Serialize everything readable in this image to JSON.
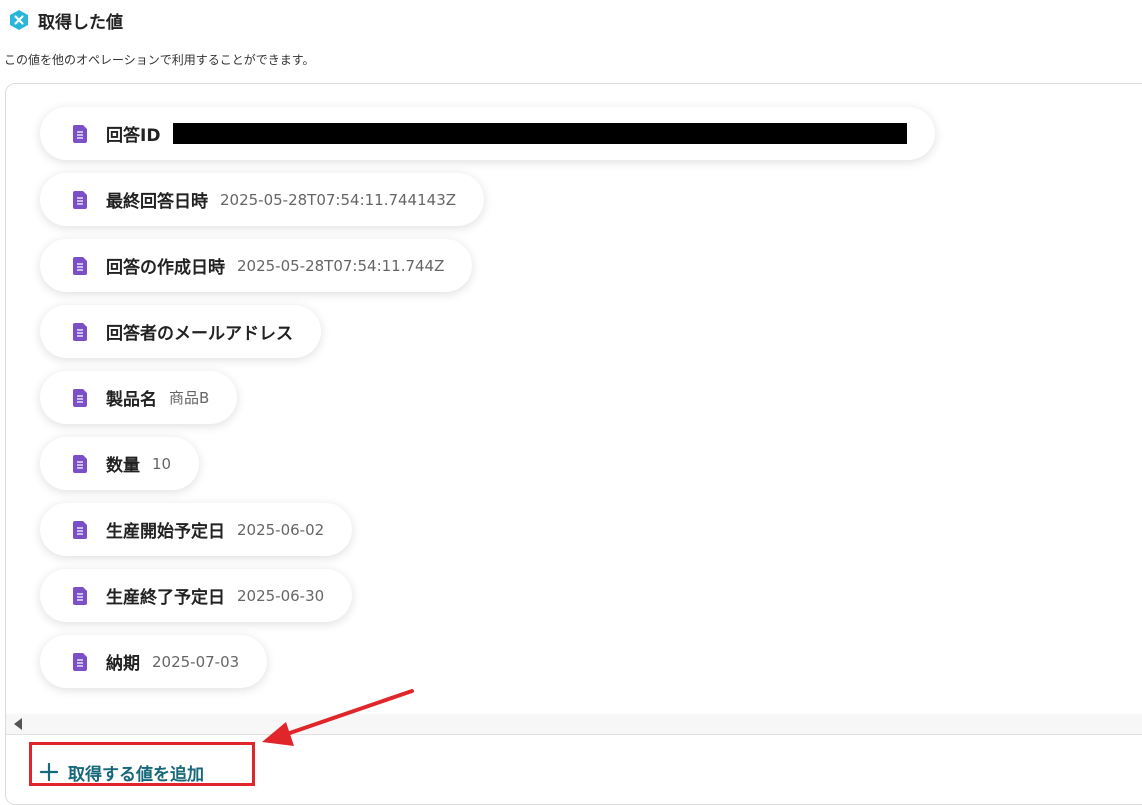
{
  "header": {
    "title": "取得した値",
    "icon": "x-hexagon-icon"
  },
  "subtitle": "この値を他のオペレーションで利用することができます。",
  "items": [
    {
      "label": "回答ID",
      "value": "",
      "redacted": true
    },
    {
      "label": "最終回答日時",
      "value": "2025-05-28T07:54:11.744143Z"
    },
    {
      "label": "回答の作成日時",
      "value": "2025-05-28T07:54:11.744Z"
    },
    {
      "label": "回答者のメールアドレス",
      "value": ""
    },
    {
      "label": "製品名",
      "value": "商品B"
    },
    {
      "label": "数量",
      "value": "10"
    },
    {
      "label": "生産開始予定日",
      "value": "2025-06-02"
    },
    {
      "label": "生産終了予定日",
      "value": "2025-06-30"
    },
    {
      "label": "納期",
      "value": "2025-07-03"
    }
  ],
  "add_button": {
    "label": "取得する値を追加",
    "icon": "plus-icon"
  },
  "colors": {
    "accent": "#17687a",
    "doc_icon": "#7b4fc6",
    "hex_icon": "#29b6d9",
    "annotation": "#e0262a"
  }
}
